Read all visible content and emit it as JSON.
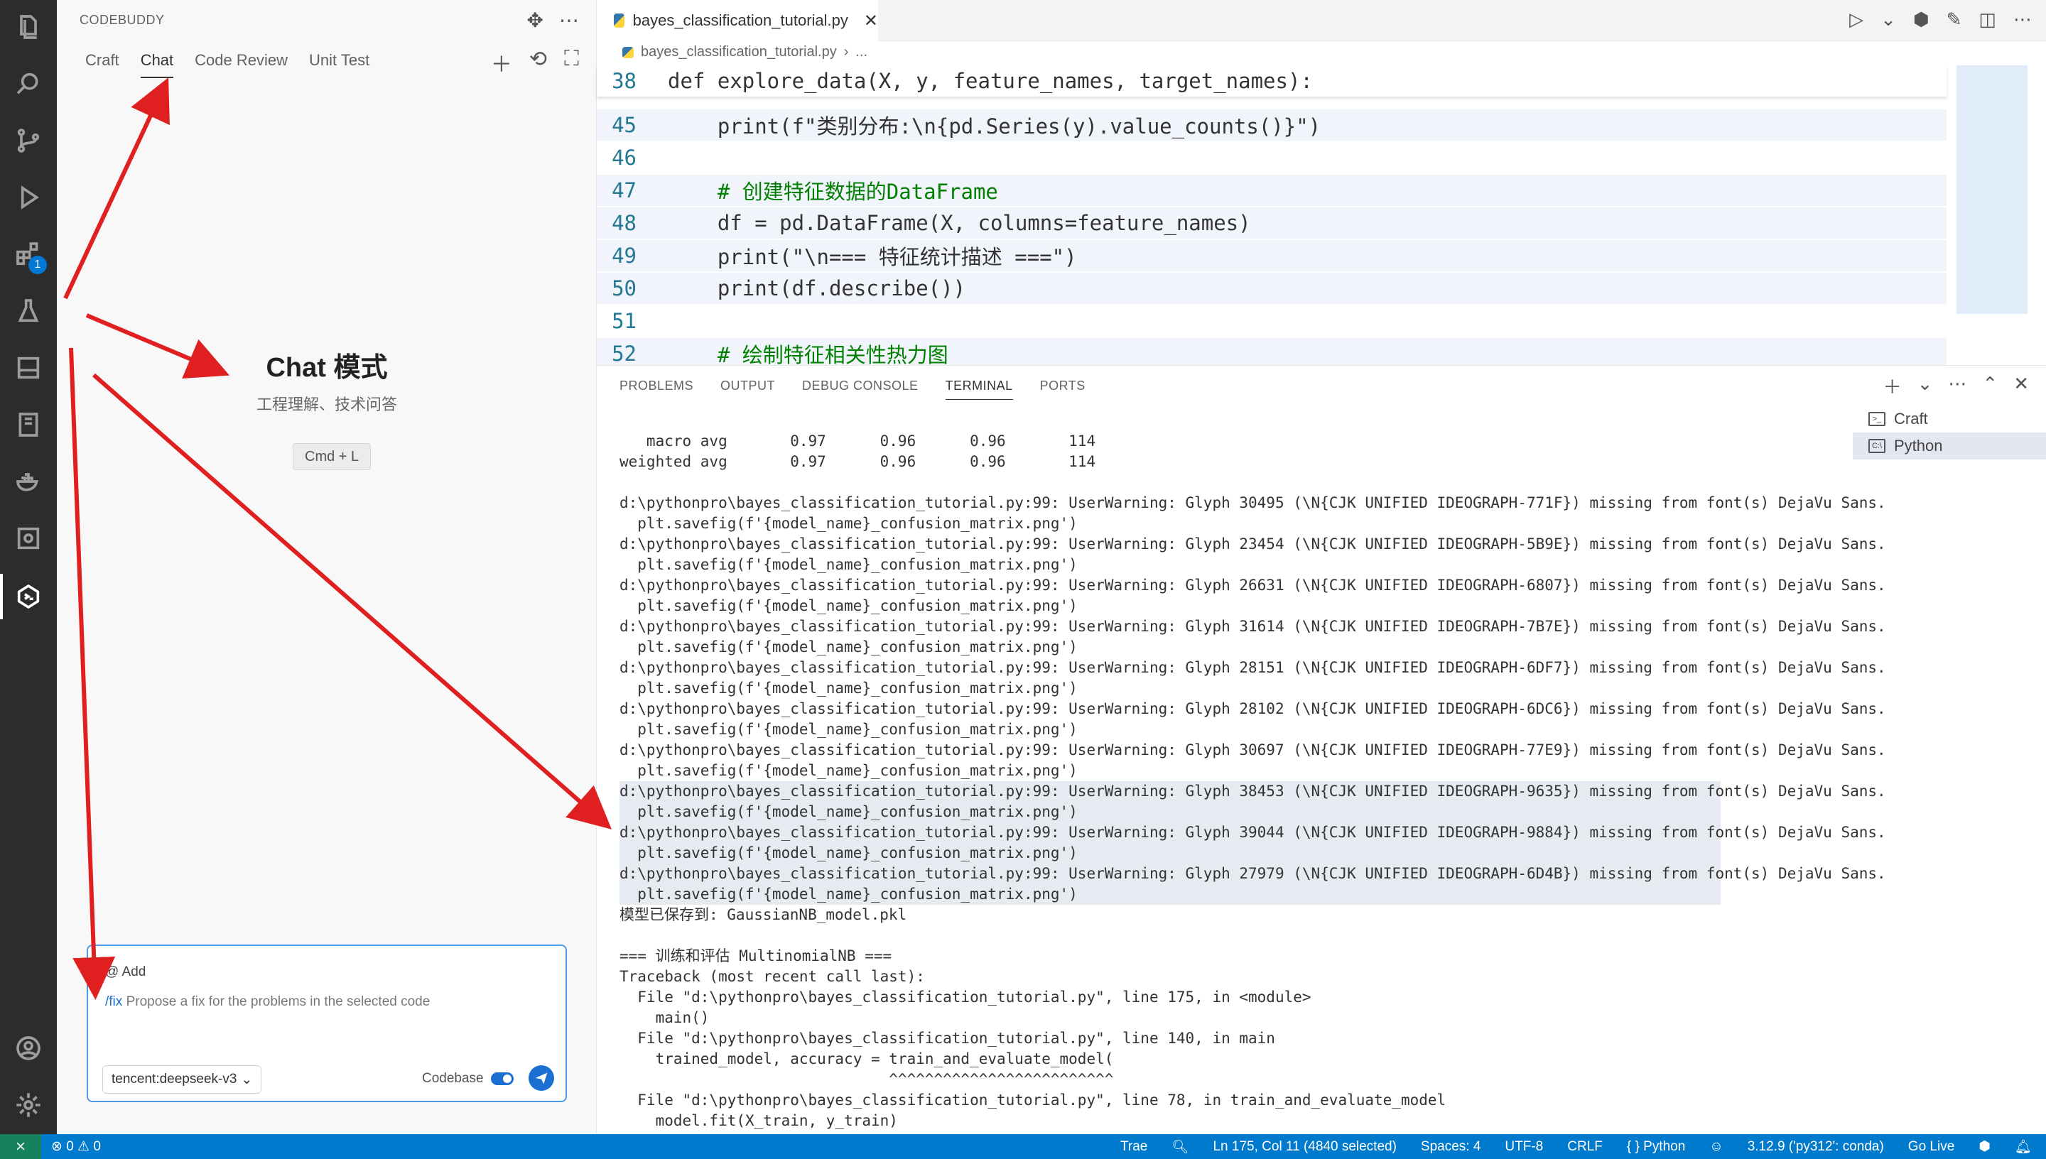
{
  "activity_bar": {
    "badge": "1",
    "icons": [
      "explorer-icon",
      "search-icon",
      "source-control-icon",
      "run-debug-icon",
      "extensions-icon",
      "testing-icon",
      "panel-icon",
      "notebook-icon",
      "docker-icon",
      "remote-icon",
      "codebuddy-icon",
      "account-icon",
      "settings-icon"
    ]
  },
  "side_panel": {
    "title": "CODEBUDDY",
    "tabs": [
      "Craft",
      "Chat",
      "Code Review",
      "Unit Test"
    ],
    "active_tab": "Chat",
    "heading": "Chat 模式",
    "subheading": "工程理解、技术问答",
    "shortcut": "Cmd + L",
    "input": {
      "add_label": "@ Add",
      "command": "/fix",
      "placeholder": "Propose a fix for the problems in the selected code",
      "model": "tencent:deepseek-v3",
      "codebase_label": "Codebase"
    }
  },
  "editor": {
    "tab_title": "bayes_classification_tutorial.py",
    "breadcrumb": [
      "bayes_classification_tutorial.py",
      "..."
    ],
    "lines": [
      {
        "n": "38",
        "text": "def explore_data(X, y, feature_names, target_names):"
      },
      {
        "n": "45",
        "text": "    print(f\"类别分布:\\n{pd.Series(y).value_counts()}\")"
      },
      {
        "n": "46",
        "text": ""
      },
      {
        "n": "47",
        "text": "    # 创建特征数据的DataFrame"
      },
      {
        "n": "48",
        "text": "    df = pd.DataFrame(X, columns=feature_names)"
      },
      {
        "n": "49",
        "text": "    print(\"\\n=== 特征统计描述 ===\")"
      },
      {
        "n": "50",
        "text": "    print(df.describe())"
      },
      {
        "n": "51",
        "text": ""
      },
      {
        "n": "52",
        "text": "    # 绘制特征相关性热力图"
      }
    ]
  },
  "panel": {
    "tabs": [
      "PROBLEMS",
      "OUTPUT",
      "DEBUG CONSOLE",
      "TERMINAL",
      "PORTS"
    ],
    "active_tab": "TERMINAL",
    "terminals": [
      "Craft",
      "Python"
    ],
    "terminal_lines": [
      "   macro avg       0.97      0.96      0.96       114",
      "weighted avg       0.97      0.96      0.96       114",
      "",
      "d:\\pythonpro\\bayes_classification_tutorial.py:99: UserWarning: Glyph 30495 (\\N{CJK UNIFIED IDEOGRAPH-771F}) missing from font(s) DejaVu Sans.",
      "  plt.savefig(f'{model_name}_confusion_matrix.png')",
      "d:\\pythonpro\\bayes_classification_tutorial.py:99: UserWarning: Glyph 23454 (\\N{CJK UNIFIED IDEOGRAPH-5B9E}) missing from font(s) DejaVu Sans.",
      "  plt.savefig(f'{model_name}_confusion_matrix.png')",
      "d:\\pythonpro\\bayes_classification_tutorial.py:99: UserWarning: Glyph 26631 (\\N{CJK UNIFIED IDEOGRAPH-6807}) missing from font(s) DejaVu Sans.",
      "  plt.savefig(f'{model_name}_confusion_matrix.png')",
      "d:\\pythonpro\\bayes_classification_tutorial.py:99: UserWarning: Glyph 31614 (\\N{CJK UNIFIED IDEOGRAPH-7B7E}) missing from font(s) DejaVu Sans.",
      "  plt.savefig(f'{model_name}_confusion_matrix.png')",
      "d:\\pythonpro\\bayes_classification_tutorial.py:99: UserWarning: Glyph 28151 (\\N{CJK UNIFIED IDEOGRAPH-6DF7}) missing from font(s) DejaVu Sans.",
      "  plt.savefig(f'{model_name}_confusion_matrix.png')",
      "d:\\pythonpro\\bayes_classification_tutorial.py:99: UserWarning: Glyph 28102 (\\N{CJK UNIFIED IDEOGRAPH-6DC6}) missing from font(s) DejaVu Sans.",
      "  plt.savefig(f'{model_name}_confusion_matrix.png')",
      "d:\\pythonpro\\bayes_classification_tutorial.py:99: UserWarning: Glyph 30697 (\\N{CJK UNIFIED IDEOGRAPH-77E9}) missing from font(s) DejaVu Sans.",
      "  plt.savefig(f'{model_name}_confusion_matrix.png')",
      "d:\\pythonpro\\bayes_classification_tutorial.py:99: UserWarning: Glyph 38453 (\\N{CJK UNIFIED IDEOGRAPH-9635}) missing from font(s) DejaVu Sans.",
      "  plt.savefig(f'{model_name}_confusion_matrix.png')",
      "d:\\pythonpro\\bayes_classification_tutorial.py:99: UserWarning: Glyph 39044 (\\N{CJK UNIFIED IDEOGRAPH-9884}) missing from font(s) DejaVu Sans.",
      "  plt.savefig(f'{model_name}_confusion_matrix.png')",
      "d:\\pythonpro\\bayes_classification_tutorial.py:99: UserWarning: Glyph 27979 (\\N{CJK UNIFIED IDEOGRAPH-6D4B}) missing from font(s) DejaVu Sans.",
      "  plt.savefig(f'{model_name}_confusion_matrix.png')",
      "模型已保存到: GaussianNB_model.pkl",
      "",
      "=== 训练和评估 MultinomialNB ===",
      "Traceback (most recent call last):",
      "  File \"d:\\pythonpro\\bayes_classification_tutorial.py\", line 175, in <module>",
      "    main()",
      "  File \"d:\\pythonpro\\bayes_classification_tutorial.py\", line 140, in main",
      "    trained_model, accuracy = train_and_evaluate_model(",
      "                              ^^^^^^^^^^^^^^^^^^^^^^^^^",
      "  File \"d:\\pythonpro\\bayes_classification_tutorial.py\", line 78, in train_and_evaluate_model",
      "    model.fit(X_train, y_train)"
    ]
  },
  "status_bar": {
    "problems": "⊗ 0 ⚠ 0",
    "trae": "Trae",
    "cursor": "Ln 175, Col 11 (4840 selected)",
    "spaces": "Spaces: 4",
    "encoding": "UTF-8",
    "eol": "CRLF",
    "language": "{ } Python",
    "interpreter": "3.12.9 ('py312': conda)",
    "golive": "Go Live"
  }
}
